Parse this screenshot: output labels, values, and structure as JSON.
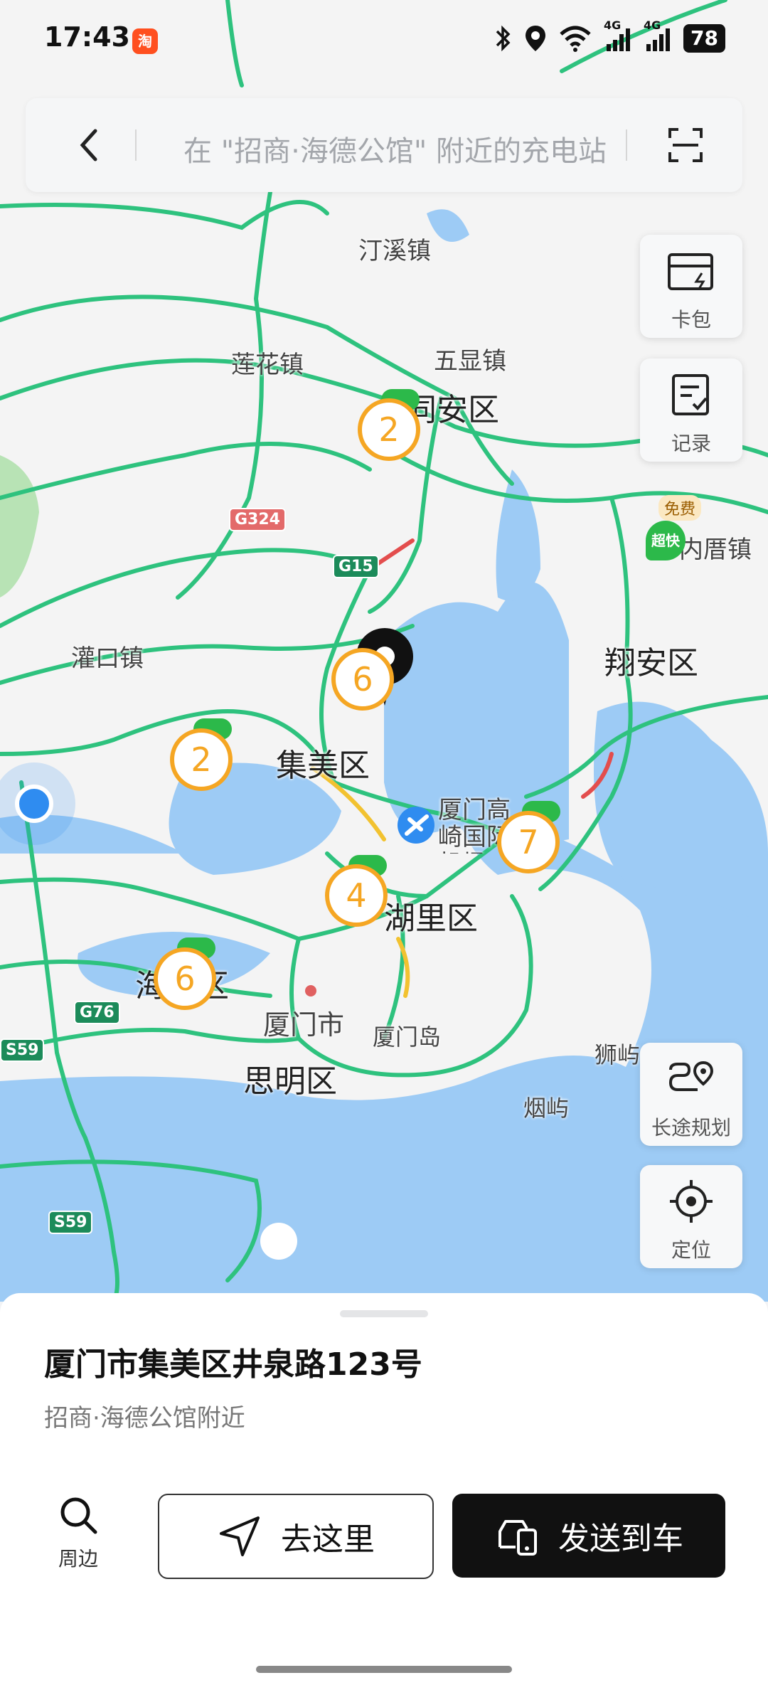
{
  "status_bar": {
    "time": "17:43",
    "app_badge": "淘",
    "battery": "78",
    "net_label_1": "4G",
    "net_label_2": "4G",
    "icons": [
      "bluetooth-icon",
      "location-icon",
      "wifi-icon",
      "signal-icon",
      "signal-icon",
      "battery-icon"
    ]
  },
  "search": {
    "placeholder": "在 \"招商·海德公馆\" 附近的充电站",
    "icons": [
      "back-arrow-icon",
      "scan-icon"
    ]
  },
  "side_buttons": {
    "card_pack": "卡包",
    "records": "记录",
    "route_planning": "长途规划",
    "locate": "定位"
  },
  "map": {
    "towns": {
      "tingxi": "汀溪镇",
      "lianhua": "莲花镇",
      "wuxian": "五显镇",
      "guankou": "灌口镇",
      "neicuo": "内厝镇",
      "xiamen_city": "厦门市",
      "xiamen_island": "厦门岛",
      "shiyu": "狮屿",
      "yanyu": "烟屿"
    },
    "districts": {
      "tongan": "同安区",
      "xiangan": "翔安区",
      "jimei": "集美区",
      "huli": "湖里区",
      "haicang": "海沧区",
      "siming": "思明区"
    },
    "airport": "厦门高崎国际机场",
    "roads": {
      "g324": "G324",
      "g15": "G15",
      "g76": "G76",
      "s59a": "S59",
      "s59b": "S59"
    },
    "poi_badges": {
      "free": "免费",
      "super_fast": "超快"
    },
    "clusters": {
      "tongan": "2",
      "jimei_north": "6",
      "jimei_west": "2",
      "huli_west": "4",
      "airport": "7",
      "haicang": "6"
    },
    "colors": {
      "water": "#9dcbf5",
      "land": "#f4f4f4",
      "road": "#2ec27e",
      "cluster": "#f5a623",
      "station": "#2cb94a"
    }
  },
  "sheet": {
    "address": "厦门市集美区井泉路123号",
    "subtitle": "招商·海德公馆附近",
    "nearby_label": "周边",
    "go_label": "去这里",
    "send_label": "发送到车"
  }
}
